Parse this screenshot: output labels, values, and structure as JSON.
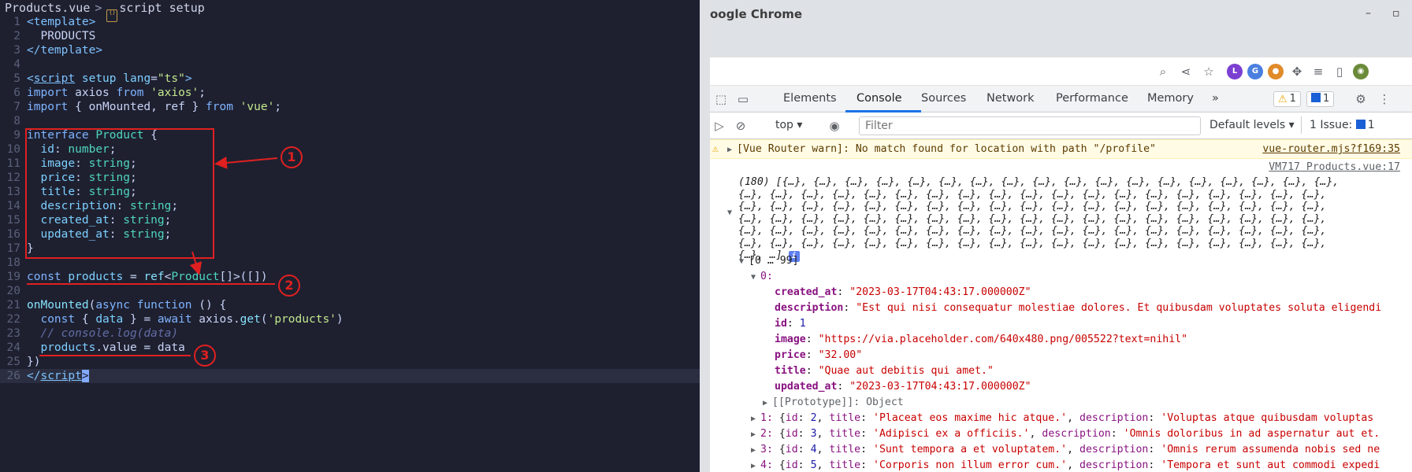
{
  "editor": {
    "breadcrumb": {
      "file": "Products.vue",
      "separator": ">",
      "symbol": "script setup"
    },
    "lines": [
      {
        "n": "1",
        "html": "<span class='tag'>&lt;template&gt;</span>"
      },
      {
        "n": "2",
        "html": "  PRODUCTS"
      },
      {
        "n": "3",
        "html": "<span class='tag'>&lt;/template&gt;</span>"
      },
      {
        "n": "4",
        "html": ""
      },
      {
        "n": "5",
        "html": "<span class='tag'>&lt;<span class='ul'>script</span></span> <span class='prop'>setup</span> <span class='prop'>lang</span>=<span class='str'>\"ts\"</span><span class='tag'>&gt;</span>"
      },
      {
        "n": "6",
        "html": "<span class='kw'>import</span> axios <span class='kw'>from</span> <span class='str'>'axios'</span>;"
      },
      {
        "n": "7",
        "html": "<span class='kw'>import</span> { onMounted, ref } <span class='kw'>from</span> <span class='str'>'vue'</span>;"
      },
      {
        "n": "8",
        "html": ""
      },
      {
        "n": "9",
        "html": "<span class='kw'>interface</span> <span class='typ'>Product</span> {"
      },
      {
        "n": "10",
        "html": "  <span class='prop'>id</span>: <span class='typ'>number</span>;"
      },
      {
        "n": "11",
        "html": "  <span class='prop'>image</span>: <span class='typ'>string</span>;"
      },
      {
        "n": "12",
        "html": "  <span class='prop'>price</span>: <span class='typ'>string</span>;"
      },
      {
        "n": "13",
        "html": "  <span class='prop'>title</span>: <span class='typ'>string</span>;"
      },
      {
        "n": "14",
        "html": "  <span class='prop'>description</span>: <span class='typ'>string</span>;"
      },
      {
        "n": "15",
        "html": "  <span class='prop'>created_at</span>: <span class='typ'>string</span>;"
      },
      {
        "n": "16",
        "html": "  <span class='prop'>updated_at</span>: <span class='typ'>string</span>;"
      },
      {
        "n": "17",
        "html": "}"
      },
      {
        "n": "18",
        "html": ""
      },
      {
        "n": "19",
        "html": "<span class='kw'>const</span> <span class='prop'>products</span> = <span class='fn'>ref</span>&lt;<span class='typ'>Product</span>[]&gt;([])"
      },
      {
        "n": "20",
        "html": ""
      },
      {
        "n": "21",
        "html": "<span class='fn'>onMounted</span>(<span class='kw'>async</span> <span class='kw'>function</span> () {"
      },
      {
        "n": "22",
        "html": "  <span class='kw'>const</span> { <span class='prop'>data</span> } = <span class='kw'>await</span> axios.<span class='fn'>get</span>(<span class='str'>'products'</span>)"
      },
      {
        "n": "23",
        "html": "  <span class='com'>// console.log(data)</span>"
      },
      {
        "n": "24",
        "html": "  <span class='prop'>products</span>.value = data"
      },
      {
        "n": "25",
        "html": "})"
      },
      {
        "n": "26",
        "html": "<span class='tag'>&lt;/<span class='ul'>script</span></span><span class='cursor'>&gt;</span>"
      }
    ],
    "callouts": [
      "1",
      "2",
      "3"
    ]
  },
  "chrome": {
    "window_title": "oogle Chrome",
    "window_buttons": [
      "–",
      "▫"
    ],
    "devtools_tabs": [
      "Elements",
      "Console",
      "Sources",
      "Network",
      "Performance",
      "Memory",
      "»"
    ],
    "active_tab": "Console",
    "warn_badge": "1",
    "info_badge": "1",
    "context": "top",
    "filter_placeholder": "Filter",
    "levels": "Default levels",
    "issues": "1 Issue:",
    "issues_count": "1"
  },
  "console": {
    "warning": "[Vue Router warn]: No match found for location with path \"/profile\"",
    "warning_source": "vue-router.mjs?f169:35",
    "log_source": "VM717 Products.vue:17",
    "array_summary": [
      "(180) [{…}, {…}, {…}, {…}, {…}, {…}, {…}, {…}, {…}, {…}, {…}, {…}, {…}, {…}, {…}, {…}, {…}, {…},",
      "{…}, {…}, {…}, {…}, {…}, {…}, {…}, {…}, {…}, {…}, {…}, {…}, {…}, {…}, {…}, {…}, {…}, {…}, {…},",
      "{…}, {…}, {…}, {…}, {…}, {…}, {…}, {…}, {…}, {…}, {…}, {…}, {…}, {…}, {…}, {…}, {…}, {…}, {…},",
      "{…}, {…}, {…}, {…}, {…}, {…}, {…}, {…}, {…}, {…}, {…}, {…}, {…}, {…}, {…}, {…}, {…}, {…}, {…},",
      "{…}, {…}, {…}, {…}, {…}, {…}, {…}, {…}, {…}, {…}, {…}, {…}, {…}, {…}, {…}, {…}, {…}, {…}, {…},",
      "{…}, {…}, {…}, {…}, {…}, {…}, {…}, {…}, {…}, {…}, {…}, {…}, {…}, {…}, {…}, {…}, {…}, {…}, {…},",
      "{…}, …]"
    ],
    "range": "[0 … 99]",
    "item0_key": "0:",
    "item0": [
      {
        "k": "created_at",
        "v": "\"2023-03-17T04:43:17.000000Z\"",
        "t": "s"
      },
      {
        "k": "description",
        "v": "\"Est qui nisi consequatur molestiae dolores. Et quibusdam voluptates soluta eligendi",
        "t": "s"
      },
      {
        "k": "id",
        "v": "1",
        "t": "n"
      },
      {
        "k": "image",
        "v": "\"https://via.placeholder.com/640x480.png/005522?text=nihil\"",
        "t": "s"
      },
      {
        "k": "price",
        "v": "\"32.00\"",
        "t": "s"
      },
      {
        "k": "title",
        "v": "\"Quae aut debitis qui amet.\"",
        "t": "s"
      },
      {
        "k": "updated_at",
        "v": "\"2023-03-17T04:43:17.000000Z\"",
        "t": "s"
      }
    ],
    "prototype": "[[Prototype]]: Object",
    "collapsed_items": [
      {
        "idx": "1:",
        "id": "2",
        "title": "'Placeat eos maxime hic atque.'",
        "desc": "'Voluptas atque quibusdam voluptas"
      },
      {
        "idx": "2:",
        "id": "3",
        "title": "'Adipisci ex a officiis.'",
        "desc": "'Omnis doloribus in ad aspernatur aut et."
      },
      {
        "idx": "3:",
        "id": "4",
        "title": "'Sunt tempora a et voluptatem.'",
        "desc": "'Omnis rerum assumenda nobis sed ne"
      },
      {
        "idx": "4:",
        "id": "5",
        "title": "'Corporis non illum error cum.'",
        "desc": "'Tempora et sunt aut commodi expedi"
      }
    ]
  }
}
